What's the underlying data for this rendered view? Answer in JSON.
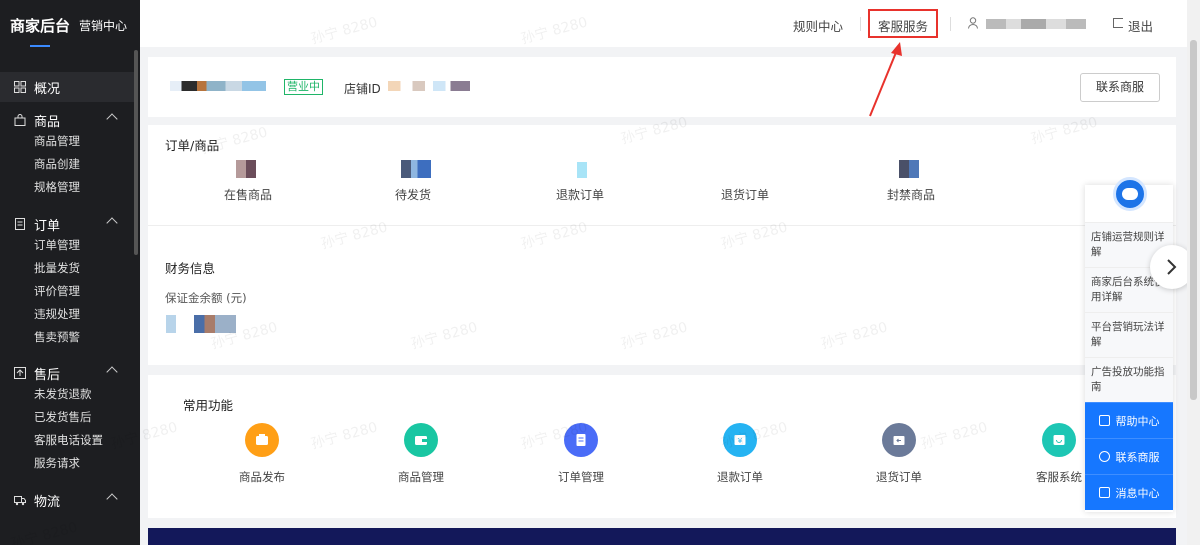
{
  "sidebar": {
    "title": "商家后台",
    "subtitle": "营销中心",
    "overview": "概况",
    "groups": [
      {
        "label": "商品",
        "items": [
          "商品管理",
          "商品创建",
          "规格管理"
        ]
      },
      {
        "label": "订单",
        "items": [
          "订单管理",
          "批量发货",
          "评价管理",
          "违规处理",
          "售卖预警"
        ]
      },
      {
        "label": "售后",
        "items": [
          "未发货退款",
          "已发货售后",
          "客服电话设置",
          "服务请求"
        ]
      },
      {
        "label": "物流",
        "items": []
      }
    ]
  },
  "topbar": {
    "rules_center": "规则中心",
    "customer_service": "客服服务",
    "logout": "退出"
  },
  "shop": {
    "status": "营业中",
    "id_label": "店铺ID",
    "contact_button": "联系商服"
  },
  "orders": {
    "title": "订单/商品",
    "items": [
      "在售商品",
      "待发货",
      "退款订单",
      "退货订单",
      "封禁商品"
    ]
  },
  "finance": {
    "title": "财务信息",
    "deposit_label": "保证金余额 (元)"
  },
  "functions": {
    "title": "常用功能",
    "items": [
      {
        "label": "商品发布",
        "color": "#ff9f16"
      },
      {
        "label": "商品管理",
        "color": "#19c6a2"
      },
      {
        "label": "订单管理",
        "color": "#4a6cf7"
      },
      {
        "label": "退款订单",
        "color": "#25b3f2"
      },
      {
        "label": "退货订单",
        "color": "#6b7a99"
      },
      {
        "label": "客服系统",
        "color": "#1dc6b4"
      }
    ]
  },
  "float_panel": {
    "questions": [
      "店铺运营规则详解",
      "商家后台系统使用详解",
      "平台营销玩法详解",
      "广告投放功能指南"
    ],
    "actions": [
      "帮助中心",
      "联系商服",
      "消息中心"
    ]
  },
  "watermark": "孙宁 8280"
}
